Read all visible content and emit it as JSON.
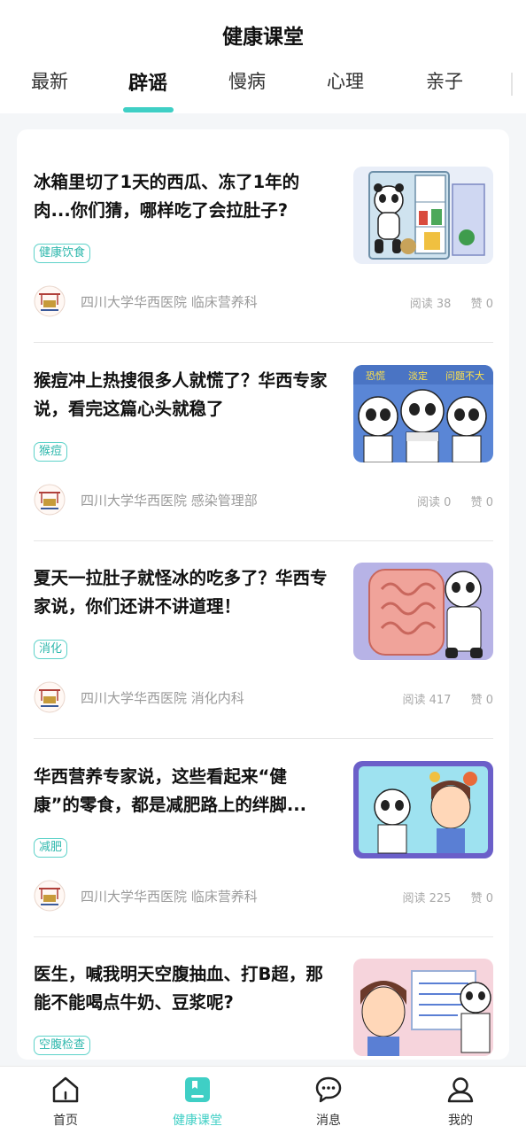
{
  "header": {
    "title": "健康课堂",
    "tabs": [
      "最新",
      "辟谣",
      "慢病",
      "心理",
      "亲子"
    ],
    "active_tab": "辟谣"
  },
  "articles": [
    {
      "title": "冰箱里切了1天的西瓜、冻了1年的肉...你们猜，哪样吃了会拉肚子?",
      "tag": "健康饮食",
      "source": "四川大学华西医院  临床营养科",
      "reads": "阅读 38",
      "likes": "赞 0",
      "thumb": "panda-fridge-illustration"
    },
    {
      "title": "猴痘冲上热搜很多人就慌了？华西专家说，看完这篇心头就稳了",
      "tag": "猴痘",
      "source": "四川大学华西医院  感染管理部",
      "reads": "阅读 0",
      "likes": "赞 0",
      "thumb": "three-pandas-illustration"
    },
    {
      "title": "夏天一拉肚子就怪冰的吃多了？华西专家说，你们还讲不讲道理！",
      "tag": "消化",
      "source": "四川大学华西医院  消化内科",
      "reads": "阅读 417",
      "likes": "赞 0",
      "thumb": "panda-intestine-illustration"
    },
    {
      "title": "华西营养专家说，这些看起来“健康”的零食，都是减肥路上的绊脚...",
      "tag": "减肥",
      "source": "四川大学华西医院  临床营养科",
      "reads": "阅读 225",
      "likes": "赞 0",
      "thumb": "panda-snacks-illustration"
    },
    {
      "title": "医生，喊我明天空腹抽血、打B超，那能不能喝点牛奶、豆浆呢?",
      "tag": "空腹检查",
      "source": "",
      "reads": "",
      "likes": "",
      "thumb": "panda-doctor-whiteboard-illustration"
    }
  ],
  "bottom_nav": [
    {
      "label": "首页",
      "icon": "home-icon"
    },
    {
      "label": "健康课堂",
      "icon": "bookmark-book-icon"
    },
    {
      "label": "消息",
      "icon": "chat-bubble-icon"
    },
    {
      "label": "我的",
      "icon": "user-icon"
    }
  ],
  "colors": {
    "accent": "#3fcfc5",
    "tag_text": "#2fb8ad",
    "background": "#f4f6f8"
  }
}
